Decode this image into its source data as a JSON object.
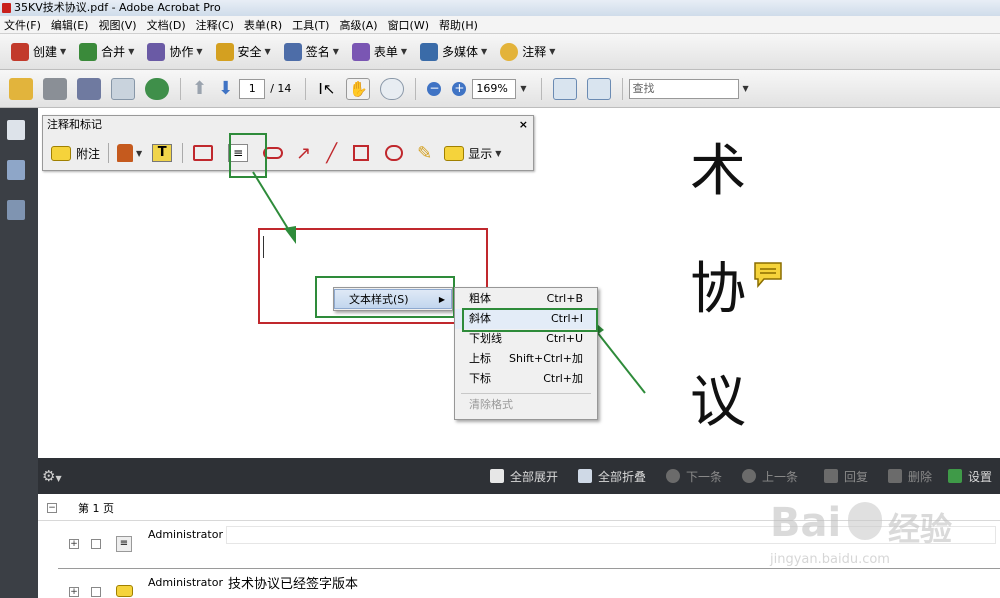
{
  "window": {
    "title": "35KV技术协议.pdf - Adobe Acrobat Pro"
  },
  "menubar": [
    "文件(F)",
    "编辑(E)",
    "视图(V)",
    "文档(D)",
    "注释(C)",
    "表单(R)",
    "工具(T)",
    "高级(A)",
    "窗口(W)",
    "帮助(H)"
  ],
  "toolbar1": [
    {
      "label": "创建",
      "color": "#c23a2b"
    },
    {
      "label": "合并",
      "color": "#3a8a3a"
    },
    {
      "label": "协作",
      "color": "#6a5aa5"
    },
    {
      "label": "安全",
      "color": "#d4a020"
    },
    {
      "label": "签名",
      "color": "#4d6da8"
    },
    {
      "label": "表单",
      "color": "#7a56b3"
    },
    {
      "label": "多媒体",
      "color": "#3a6ba8"
    },
    {
      "label": "注释",
      "color": "#e3b33a"
    }
  ],
  "toolbar2": {
    "page_current": "1",
    "page_total": "/ 14",
    "zoom": "169%",
    "find_placeholder": "查找"
  },
  "comment_toolbar": {
    "title": "注释和标记",
    "close": "×",
    "note_label": "附注",
    "show_label": "显示"
  },
  "document": {
    "chars": [
      "术",
      "协",
      "议"
    ]
  },
  "context_menu": {
    "item": "文本样式(S)"
  },
  "submenu": [
    {
      "label": "粗体",
      "shortcut": "Ctrl+B",
      "enabled": true
    },
    {
      "label": "斜体",
      "shortcut": "Ctrl+I",
      "enabled": true
    },
    {
      "label": "下划线",
      "shortcut": "Ctrl+U",
      "enabled": true
    },
    {
      "label": "上标",
      "shortcut": "Shift+Ctrl+加",
      "enabled": true
    },
    {
      "label": "下标",
      "shortcut": "Ctrl+加",
      "enabled": true
    },
    {
      "label": "清除格式",
      "shortcut": "",
      "enabled": false
    }
  ],
  "comment_list": {
    "expand_all": "全部展开",
    "collapse_all": "全部折叠",
    "next": "下一条",
    "prev": "上一条",
    "reply": "回复",
    "delete": "删除",
    "settings": "设置",
    "page_label": "第 1 页",
    "entries": [
      {
        "author": "Administrator",
        "text": ""
      },
      {
        "author": "Administrator",
        "text": "技术协议已经签字版本"
      }
    ]
  },
  "watermark": {
    "line1": "Bai",
    "line2": "经验",
    "url": "jingyan.baidu.com"
  },
  "colors": {
    "annotation_red": "#c0282d",
    "highlight_green": "#2e8b3a",
    "arrow_green": "#2e8b3a"
  }
}
